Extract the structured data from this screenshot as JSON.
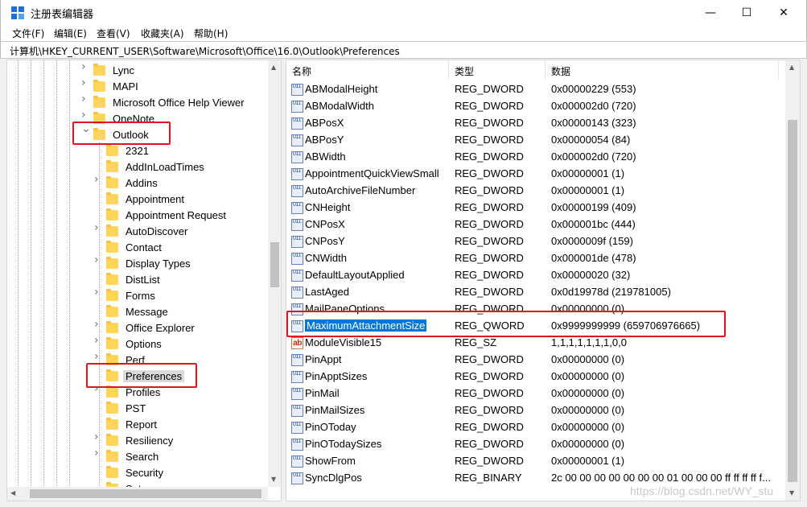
{
  "window": {
    "title": "注册表编辑器",
    "minimize": "—",
    "maximize": "☐",
    "close": "✕",
    "icon": "regedit-icon"
  },
  "menu": [
    "文件(F)",
    "编辑(E)",
    "查看(V)",
    "收藏夹(A)",
    "帮助(H)"
  ],
  "address": "计算机\\HKEY_CURRENT_USER\\Software\\Microsoft\\Office\\16.0\\Outlook\\Preferences",
  "tree": [
    {
      "label": "Lync",
      "level": 1,
      "expander": "collapsed"
    },
    {
      "label": "MAPI",
      "level": 1,
      "expander": "collapsed"
    },
    {
      "label": "Microsoft Office Help Viewer",
      "level": 1,
      "expander": "collapsed"
    },
    {
      "label": "OneNote",
      "level": 1,
      "expander": "collapsed"
    },
    {
      "label": "Outlook",
      "level": 1,
      "expander": "expanded"
    },
    {
      "label": "2321",
      "level": 2,
      "expander": "none"
    },
    {
      "label": "AddInLoadTimes",
      "level": 2,
      "expander": "none"
    },
    {
      "label": "Addins",
      "level": 2,
      "expander": "collapsed"
    },
    {
      "label": "Appointment",
      "level": 2,
      "expander": "none"
    },
    {
      "label": "Appointment Request",
      "level": 2,
      "expander": "none"
    },
    {
      "label": "AutoDiscover",
      "level": 2,
      "expander": "collapsed"
    },
    {
      "label": "Contact",
      "level": 2,
      "expander": "none"
    },
    {
      "label": "Display Types",
      "level": 2,
      "expander": "collapsed"
    },
    {
      "label": "DistList",
      "level": 2,
      "expander": "none"
    },
    {
      "label": "Forms",
      "level": 2,
      "expander": "collapsed"
    },
    {
      "label": "Message",
      "level": 2,
      "expander": "none"
    },
    {
      "label": "Office Explorer",
      "level": 2,
      "expander": "collapsed"
    },
    {
      "label": "Options",
      "level": 2,
      "expander": "collapsed"
    },
    {
      "label": "Perf",
      "level": 2,
      "expander": "collapsed"
    },
    {
      "label": "Preferences",
      "level": 2,
      "expander": "none",
      "selected": true
    },
    {
      "label": "Profiles",
      "level": 2,
      "expander": "collapsed"
    },
    {
      "label": "PST",
      "level": 2,
      "expander": "none"
    },
    {
      "label": "Report",
      "level": 2,
      "expander": "none"
    },
    {
      "label": "Resiliency",
      "level": 2,
      "expander": "collapsed"
    },
    {
      "label": "Search",
      "level": 2,
      "expander": "collapsed"
    },
    {
      "label": "Security",
      "level": 2,
      "expander": "none"
    },
    {
      "label": "Setup",
      "level": 2,
      "expander": "none"
    }
  ],
  "columns": {
    "name": "名称",
    "type": "类型",
    "data": "数据"
  },
  "values": [
    {
      "name": "ABModalHeight",
      "type": "REG_DWORD",
      "data": "0x00000229 (553)",
      "icon": "dword-icon"
    },
    {
      "name": "ABModalWidth",
      "type": "REG_DWORD",
      "data": "0x000002d0 (720)",
      "icon": "dword-icon"
    },
    {
      "name": "ABPosX",
      "type": "REG_DWORD",
      "data": "0x00000143 (323)",
      "icon": "dword-icon"
    },
    {
      "name": "ABPosY",
      "type": "REG_DWORD",
      "data": "0x00000054 (84)",
      "icon": "dword-icon"
    },
    {
      "name": "ABWidth",
      "type": "REG_DWORD",
      "data": "0x000002d0 (720)",
      "icon": "dword-icon"
    },
    {
      "name": "AppointmentQuickViewSmall",
      "type": "REG_DWORD",
      "data": "0x00000001 (1)",
      "icon": "dword-icon"
    },
    {
      "name": "AutoArchiveFileNumber",
      "type": "REG_DWORD",
      "data": "0x00000001 (1)",
      "icon": "dword-icon"
    },
    {
      "name": "CNHeight",
      "type": "REG_DWORD",
      "data": "0x00000199 (409)",
      "icon": "dword-icon"
    },
    {
      "name": "CNPosX",
      "type": "REG_DWORD",
      "data": "0x000001bc (444)",
      "icon": "dword-icon"
    },
    {
      "name": "CNPosY",
      "type": "REG_DWORD",
      "data": "0x0000009f (159)",
      "icon": "dword-icon"
    },
    {
      "name": "CNWidth",
      "type": "REG_DWORD",
      "data": "0x000001de (478)",
      "icon": "dword-icon"
    },
    {
      "name": "DefaultLayoutApplied",
      "type": "REG_DWORD",
      "data": "0x00000020 (32)",
      "icon": "dword-icon"
    },
    {
      "name": "LastAged",
      "type": "REG_DWORD",
      "data": "0x0d19978d (219781005)",
      "icon": "dword-icon"
    },
    {
      "name": "MailPaneOptions",
      "type": "REG_DWORD",
      "data": "0x00000000 (0)",
      "icon": "dword-icon"
    },
    {
      "name": "MaximumAttachmentSize",
      "type": "REG_QWORD",
      "data": "0x9999999999 (659706976665)",
      "icon": "qword-icon",
      "selected": true
    },
    {
      "name": "ModuleVisible15",
      "type": "REG_SZ",
      "data": "1,1,1,1,1,1,1,0,0",
      "icon": "string-icon"
    },
    {
      "name": "PinAppt",
      "type": "REG_DWORD",
      "data": "0x00000000 (0)",
      "icon": "dword-icon"
    },
    {
      "name": "PinApptSizes",
      "type": "REG_DWORD",
      "data": "0x00000000 (0)",
      "icon": "dword-icon"
    },
    {
      "name": "PinMail",
      "type": "REG_DWORD",
      "data": "0x00000000 (0)",
      "icon": "dword-icon"
    },
    {
      "name": "PinMailSizes",
      "type": "REG_DWORD",
      "data": "0x00000000 (0)",
      "icon": "dword-icon"
    },
    {
      "name": "PinOToday",
      "type": "REG_DWORD",
      "data": "0x00000000 (0)",
      "icon": "dword-icon"
    },
    {
      "name": "PinOTodaySizes",
      "type": "REG_DWORD",
      "data": "0x00000000 (0)",
      "icon": "dword-icon"
    },
    {
      "name": "ShowFrom",
      "type": "REG_DWORD",
      "data": "0x00000001 (1)",
      "icon": "dword-icon"
    },
    {
      "name": "SyncDlgPos",
      "type": "REG_BINARY",
      "data": "2c 00 00 00 00 00 00 00 01 00 00 00 ff ff ff ff f...",
      "icon": "binary-icon"
    }
  ],
  "watermark": "https://blog.csdn.net/WY_stu",
  "colors": {
    "highlight_box": "#e0141e",
    "selection": "#0078d7",
    "folder": "#ffd55b"
  }
}
